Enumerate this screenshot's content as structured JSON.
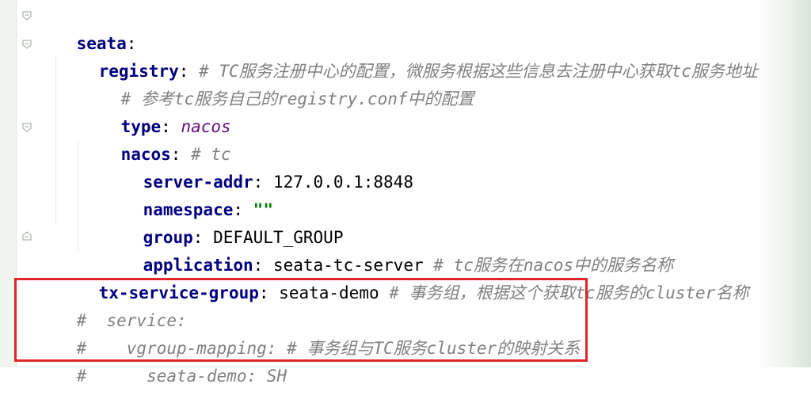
{
  "editor": {
    "lines": [
      {
        "key": "seata",
        "sep": ":"
      },
      {
        "key": "registry",
        "sep": ":",
        "comment": " # TC服务注册中心的配置，微服务根据这些信息去注册中心获取tc服务地址"
      },
      {
        "comment": "# 参考tc服务自己的registry.conf中的配置"
      },
      {
        "key": "type",
        "sep": ":",
        "value": " nacos"
      },
      {
        "key": "nacos",
        "sep": ":",
        "comment": " # tc"
      },
      {
        "key": "server-addr",
        "sep": ":",
        "value": " 127.0.0.1:8848"
      },
      {
        "key": "namespace",
        "sep": ":",
        "value": " \"\""
      },
      {
        "key": "group",
        "sep": ":",
        "value": " DEFAULT_GROUP"
      },
      {
        "key": "application",
        "sep": ":",
        "value": " seata-tc-server",
        "comment": " # tc服务在nacos中的服务名称"
      },
      {
        "key": "tx-service-group",
        "sep": ":",
        "value": " seata-demo",
        "comment": " # 事务组，根据这个获取tc服务的cluster名称"
      },
      {
        "comment": "#  service:"
      },
      {
        "comment": "#    vgroup-mapping: # 事务组与TC服务cluster的映射关系"
      },
      {
        "comment": "#      seata-demo: SH"
      }
    ]
  },
  "colors": {
    "key": "#000080",
    "keyword_value": "#660e7a",
    "string": "#008000",
    "comment": "#808080",
    "highlight_border": "#e0262a"
  }
}
